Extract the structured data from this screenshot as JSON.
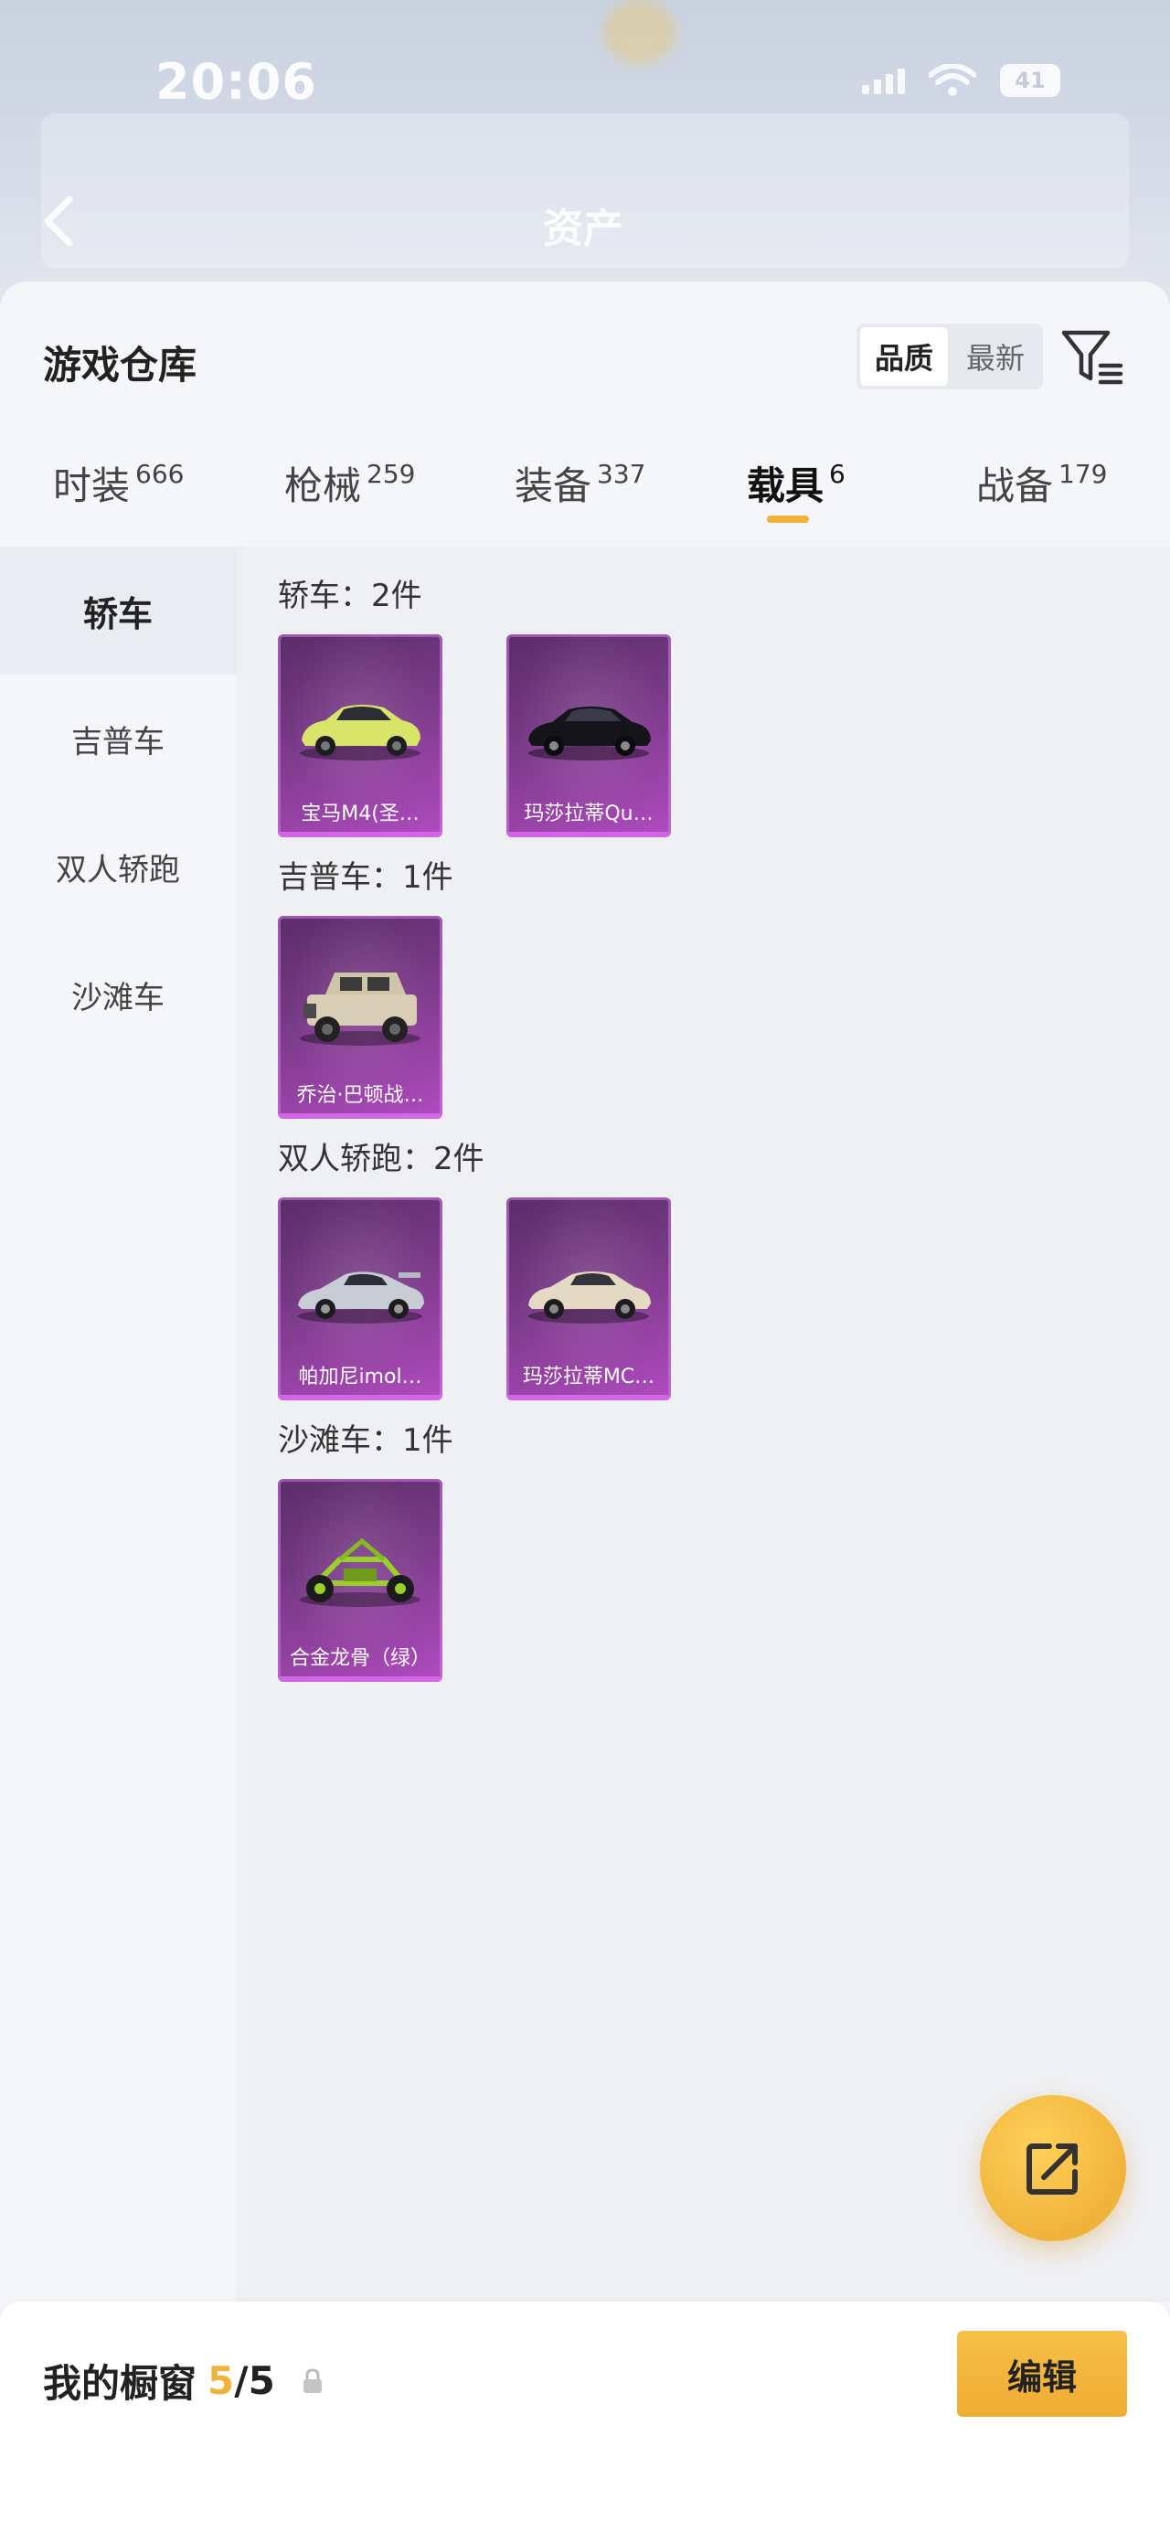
{
  "status_bar": {
    "time": "20:06",
    "battery": "41"
  },
  "background_page": {
    "title": "资产"
  },
  "sheet": {
    "title": "游戏仓库",
    "sort_options": [
      "品质",
      "最新"
    ],
    "active_sort": "品质"
  },
  "tabs": [
    {
      "label": "时装",
      "count": "666"
    },
    {
      "label": "枪械",
      "count": "259"
    },
    {
      "label": "装备",
      "count": "337"
    },
    {
      "label": "载具",
      "count": "6"
    },
    {
      "label": "战备",
      "count": "179"
    }
  ],
  "active_tab": "载具",
  "sidebar": {
    "items": [
      "轿车",
      "吉普车",
      "双人轿跑",
      "沙滩车"
    ],
    "active": "轿车"
  },
  "sections": [
    {
      "label": "轿车：2件",
      "items": [
        "宝马M4(圣…",
        "玛莎拉蒂Qu…"
      ]
    },
    {
      "label": "吉普车：1件",
      "items": [
        "乔治·巴顿战…"
      ]
    },
    {
      "label": "双人轿跑：2件",
      "items": [
        "帕加尼imol…",
        "玛莎拉蒂MC…"
      ]
    },
    {
      "label": "沙滩车：1件",
      "items": [
        "合金龙骨（绿）"
      ]
    }
  ],
  "showcase": {
    "label": "我的橱窗",
    "current": "5",
    "total": "/5",
    "edit_label": "编辑"
  },
  "colors": {
    "accent": "#f0b33a",
    "card_purple": "#7a3a88"
  }
}
